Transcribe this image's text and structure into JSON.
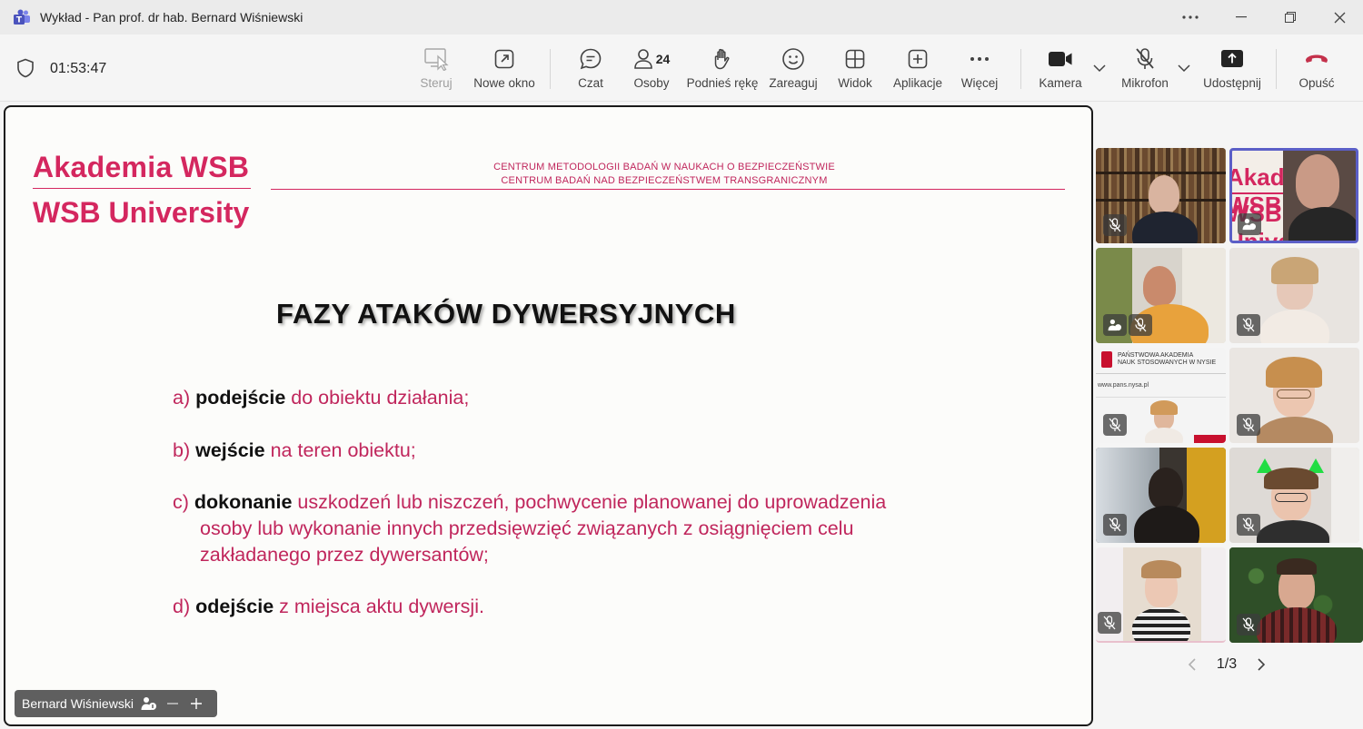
{
  "window": {
    "title": "Wykład - Pan prof. dr hab. Bernard Wiśniewski"
  },
  "toolbar": {
    "timer": "01:53:47",
    "buttons": {
      "steruj": "Steruj",
      "nowe_okno": "Nowe okno",
      "czat": "Czat",
      "osoby": "Osoby",
      "osoby_count": "24",
      "podnies": "Podnieś rękę",
      "zareaguj": "Zareaguj",
      "widok": "Widok",
      "aplikacje": "Aplikacje",
      "wiecej": "Więcej",
      "kamera": "Kamera",
      "mikrofon": "Mikrofon",
      "udostepnij": "Udostępnij",
      "opusc": "Opuść"
    }
  },
  "slide": {
    "logo_line1": "Akademia WSB",
    "logo_line2": "WSB University",
    "header_line1": "CENTRUM METODOLOGII BADAŃ W NAUKACH O BEZPIECZEŃSTWIE",
    "header_line2": "CENTRUM BADAŃ NAD BEZPIECZEŃSTWEM TRANSGRANICZNYM",
    "title": "FAZY ATAKÓW DYWERSYJNYCH",
    "items": [
      {
        "marker": "a)",
        "bold": "podejście",
        "text": "do obiektu działania;"
      },
      {
        "marker": "b)",
        "bold": "wejście",
        "text": "na teren obiektu;"
      },
      {
        "marker": "c)",
        "bold": "dokonanie",
        "text": "uszkodzeń lub niszczeń, pochwycenie planowanej do uprowadzenia",
        "cont1": "osoby lub wykonanie innych przedsięwzięć związanych z osiągnięciem celu",
        "cont2": "zakładanego przez dywersantów;"
      },
      {
        "marker": "d)",
        "bold": "odejście",
        "text": "z miejsca aktu dywersji."
      }
    ]
  },
  "presenter": {
    "name": "Bernard Wiśniewski"
  },
  "tile_logo": {
    "text1": "PAŃSTWOWA AKADEMIA",
    "text2": "NAUK STOSOWANYCH W NYSIE",
    "url": "www.pans.nysa.pl"
  },
  "pager": {
    "label": "1/3"
  },
  "colors": {
    "accent": "#d4275f",
    "active_tile": "#5b5fc7",
    "leave": "#c4314b"
  }
}
